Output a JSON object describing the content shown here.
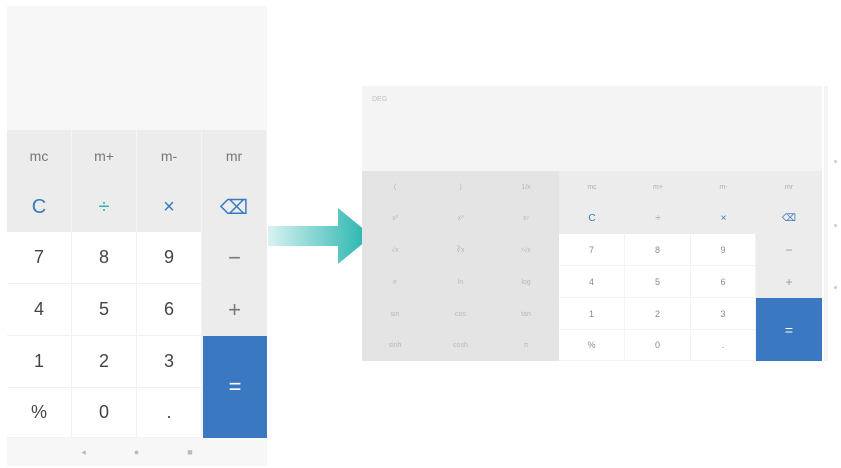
{
  "portrait": {
    "memory_keys": [
      "mc",
      "m+",
      "m-",
      "mr"
    ],
    "operator_row": [
      {
        "label": "C",
        "color": "#3a78c2"
      },
      {
        "label": "÷",
        "color": "#2bb3a7"
      },
      {
        "label": "×",
        "color": "#3a78c2"
      },
      {
        "label": "⌫",
        "color": "#3a78c2"
      }
    ],
    "digit_rows": [
      [
        "7",
        "8",
        "9"
      ],
      [
        "4",
        "5",
        "6"
      ],
      [
        "1",
        "2",
        "3"
      ],
      [
        "%",
        "0",
        "."
      ]
    ],
    "operator_column": [
      "−",
      "+"
    ],
    "equals": "=",
    "nav_icons": [
      "◂",
      "●",
      "■"
    ]
  },
  "landscape": {
    "mode_label": "DEG",
    "science_rows": [
      [
        "(",
        ")",
        "1/x"
      ],
      [
        "x²",
        "x³",
        "xʸ"
      ],
      [
        "√x",
        "∛x",
        "ʸ√x"
      ],
      [
        "e",
        "ln",
        "log"
      ],
      [
        "sin",
        "cos",
        "tan"
      ],
      [
        "sinh",
        "cosh",
        "π"
      ]
    ],
    "memory_keys": [
      "mc",
      "m+",
      "m-",
      "mr"
    ],
    "operator_row": [
      "C",
      "÷",
      "×",
      "⌫"
    ],
    "digit_rows": [
      [
        "7",
        "8",
        "9"
      ],
      [
        "4",
        "5",
        "6"
      ],
      [
        "1",
        "2",
        "3"
      ],
      [
        "%",
        "0",
        "."
      ]
    ],
    "operator_column": [
      "−",
      "+"
    ],
    "equals": "=",
    "accent_color": "#3a78c2"
  },
  "arrow_colors": [
    "#d9f2f2",
    "#20b2aa"
  ]
}
